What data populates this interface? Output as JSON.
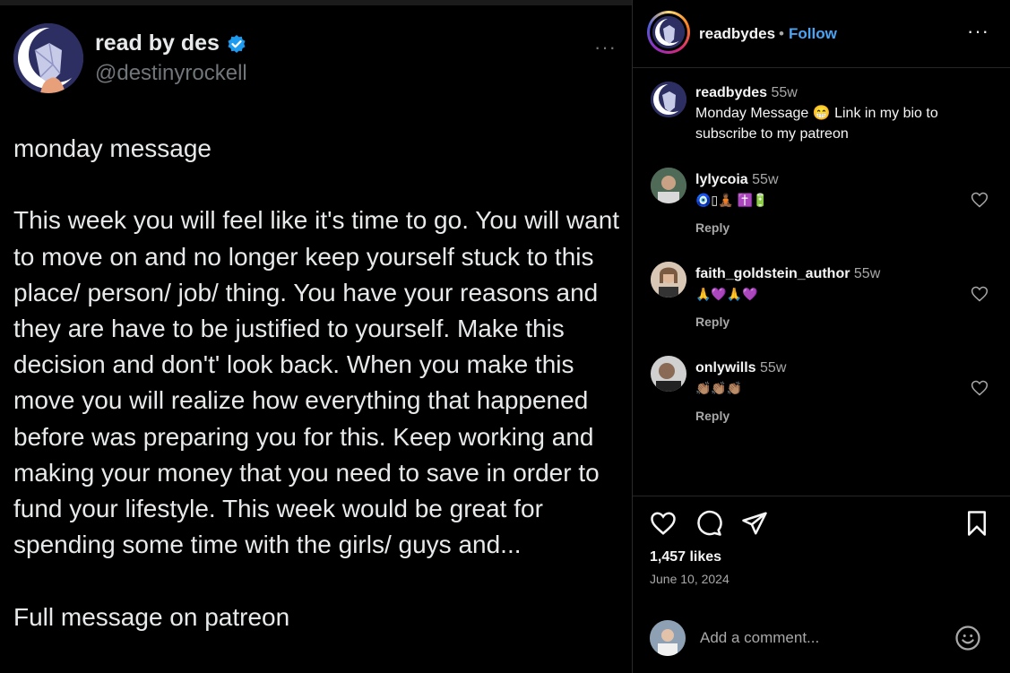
{
  "tweet": {
    "display_name": "read by des",
    "handle": "@destinyrockell",
    "more": "···",
    "text": "monday message\n\nThis week you will feel like it's time to go. You will want to move on and no longer keep yourself stuck to this place/ person/ job/ thing. You have your reasons and they are have to be justified to yourself. Make this decision and don't' look back. When you make this move you will realize how everything that happened before was preparing you for this. Keep working and making your money that you need to save in order to fund your lifestyle. This week would be great for spending some time with the girls/ guys and...\n\nFull message on patreon"
  },
  "ig": {
    "header": {
      "username": "readbydes",
      "separator": "•",
      "follow_label": "Follow",
      "more": "···"
    },
    "caption": {
      "username": "readbydes",
      "time": "55w",
      "text": "Monday Message 😁 Link in my bio to subscribe to my patreon"
    },
    "comments": [
      {
        "username": "lylycoia",
        "time": "55w",
        "text": "🧿▯🧘🏾 ✝️🔋",
        "reply": "Reply"
      },
      {
        "username": "faith_goldstein_author",
        "time": "55w",
        "text": "🙏💜🙏💜",
        "reply": "Reply"
      },
      {
        "username": "onlywills",
        "time": "55w",
        "text": "👏🏽👏🏽👏🏽",
        "reply": "Reply"
      }
    ],
    "likes": "1,457 likes",
    "date": "June 10, 2024",
    "add_comment_placeholder": "Add a comment...",
    "colors": {
      "follow": "#4ba3f5",
      "verified": "#1d9bf0"
    }
  }
}
